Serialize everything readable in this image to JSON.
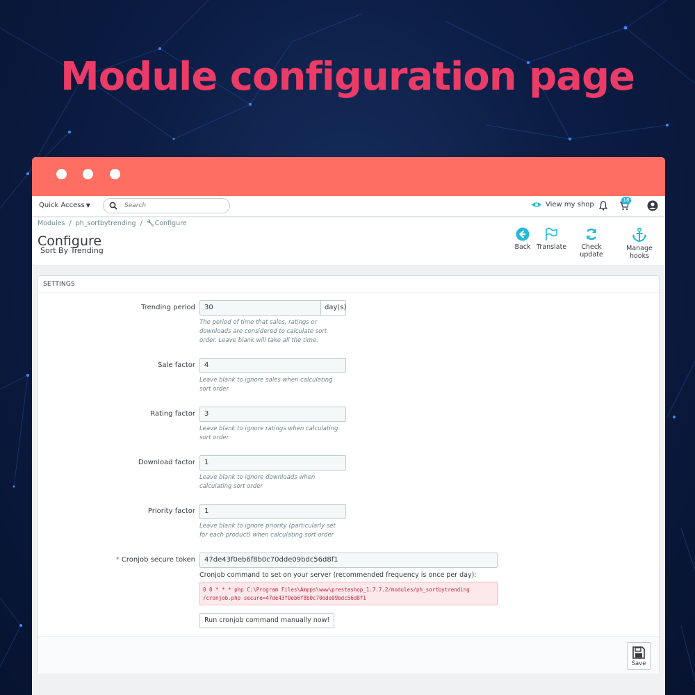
{
  "headline": "Module configuration page",
  "colors": {
    "accent": "#ea3c67",
    "titlebar": "#fe6e62",
    "link_blue": "#25b9d7"
  },
  "topbar": {
    "quick_access": "Quick Access",
    "search_placeholder": "Search",
    "view_shop": "View my shop",
    "cart_count": "18"
  },
  "breadcrumb": [
    "Modules",
    "ph_sortbytrending",
    "Configure"
  ],
  "page": {
    "title": "Configure",
    "subtitle": "Sort By Trending"
  },
  "toolbar": [
    {
      "label": "Back",
      "icon": "back-arrow-icon"
    },
    {
      "label": "Translate",
      "icon": "flag-icon"
    },
    {
      "label": "Check update",
      "icon": "refresh-icon"
    },
    {
      "label": "Manage hooks",
      "icon": "anchor-icon"
    }
  ],
  "settings": {
    "title": "SETTINGS",
    "trending_period": {
      "label": "Trending period",
      "value": "30",
      "suffix": "day(s)",
      "help": "The period of time that sales, ratings or downloads are considered to calculate sort order. Leave blank will take all the time."
    },
    "sale_factor": {
      "label": "Sale factor",
      "value": "4",
      "help": "Leave blank to ignore sales when calculating sort order"
    },
    "rating_factor": {
      "label": "Rating factor",
      "value": "3",
      "help": "Leave blank to ignore ratings when calculating sort order"
    },
    "download_factor": {
      "label": "Download factor",
      "value": "1",
      "help": "Leave blank to ignore downloads when calculating sort order"
    },
    "priority_factor": {
      "label": "Priority factor",
      "value": "1",
      "help": "Leave blank to ignore priority (particularly set for each product) when calculating sort order"
    },
    "cron_token": {
      "label": "Cronjob secure token",
      "required_mark": "*",
      "value": "47de43f0eb6f8b0c70dde09bdc56d8f1",
      "command_label": "Cronjob command to set on your server (recommended frequency is once per day):",
      "command_line1": "0 0 * * * php C:\\Program Files\\Ampps\\www\\prestashop_1.7.7.2/modules/ph_sortbytrending",
      "command_line2": "/cronjob.php secure=47de43f0eb6f8b0c70dde09bdc56d8f1",
      "run_button": "Run cronjob command manually now!"
    },
    "save_label": "Save"
  }
}
